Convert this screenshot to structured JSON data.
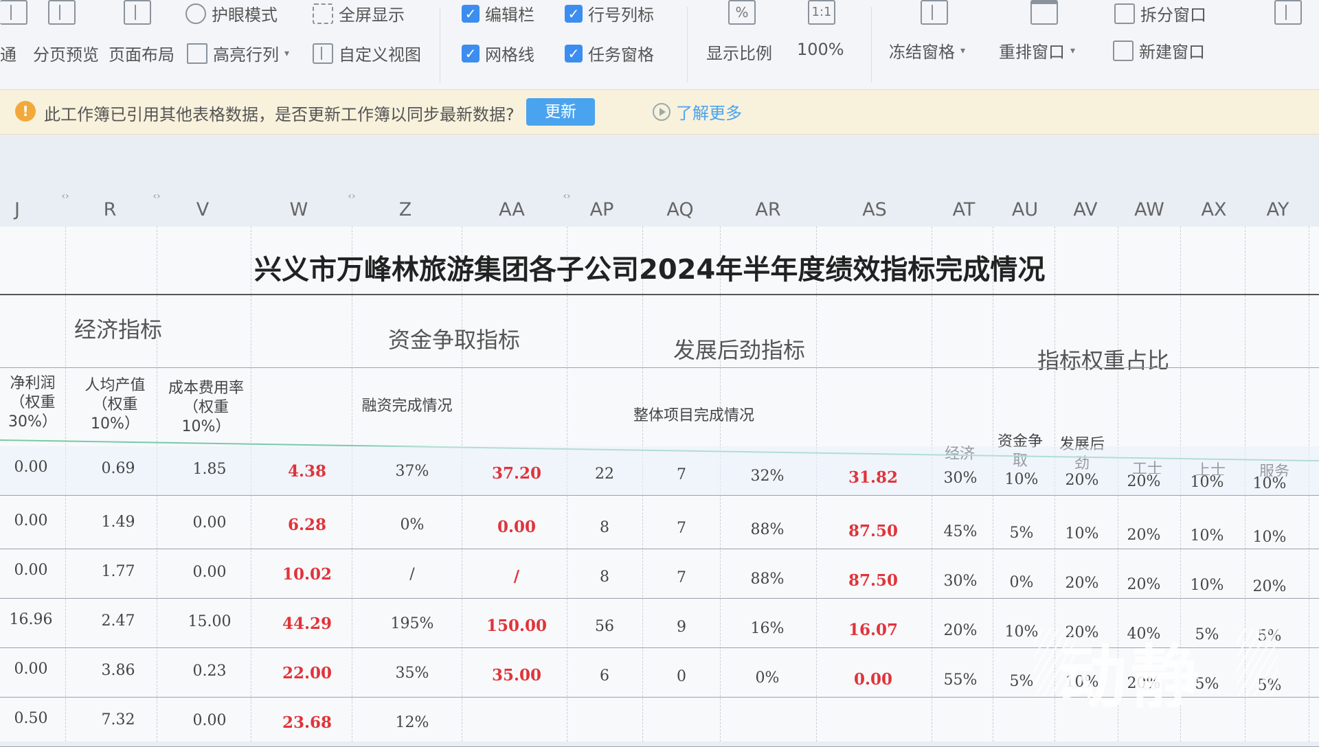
{
  "ribbon": {
    "row1": [
      {
        "name": "eye-protection-button",
        "label": "护眼模式"
      },
      {
        "name": "fullscreen-button",
        "label": "全屏显示"
      },
      {
        "name": "edit-bar-checkbox",
        "label": "编辑栏"
      },
      {
        "name": "row-col-headers-checkbox",
        "label": "行号列标"
      },
      {
        "name": "split-window-button",
        "label": "拆分窗口"
      }
    ],
    "row2": [
      {
        "name": "normal-view-button",
        "label": "通"
      },
      {
        "name": "page-break-preview-button",
        "label": "分页预览"
      },
      {
        "name": "page-layout-button",
        "label": "页面布局"
      },
      {
        "name": "highlight-rowcol-button",
        "label": "高亮行列"
      },
      {
        "name": "custom-view-button",
        "label": "自定义视图"
      },
      {
        "name": "gridlines-checkbox",
        "label": "网格线"
      },
      {
        "name": "task-pane-checkbox",
        "label": "任务窗格"
      },
      {
        "name": "zoom-ratio-button",
        "label": "显示比例"
      },
      {
        "name": "zoom-100-button",
        "label": "100%"
      },
      {
        "name": "freeze-panes-button",
        "label": "冻结窗格"
      },
      {
        "name": "arrange-window-button",
        "label": "重排窗口"
      },
      {
        "name": "new-window-button",
        "label": "新建窗口"
      }
    ],
    "zoom_icon": "%",
    "one_to_one_icon": "1:1"
  },
  "notice": {
    "text": "此工作簿已引用其他表格数据，是否更新工作簿以同步最新数据?",
    "update_label": "更新",
    "learn_more": "了解更多"
  },
  "columns": [
    "J",
    "R",
    "V",
    "W",
    "Z",
    "AA",
    "AP",
    "AQ",
    "AR",
    "AS",
    "AT",
    "AU",
    "AV",
    "AW",
    "AX",
    "AY"
  ],
  "sheet": {
    "title": "兴义市万峰林旅游集团各子公司2024年半年度绩效指标完成情况",
    "groups": {
      "economic": "经济指标",
      "funding": "资金争取指标",
      "development": "发展后劲指标",
      "weights": "指标权重占比"
    },
    "subheaders": {
      "net_profit": "净利润（权重30%）",
      "per_capita": "人均产值（权重10%）",
      "cost_rate": "成本费用率（权重10%）",
      "financing": "融资完成情况",
      "projects": "整体项目完成情况",
      "w_economic": "经济",
      "w_funding": "资金争取",
      "w_development": "发展后劲",
      "w_col4": "工士",
      "w_col5": "上士",
      "w_col6": "服务"
    },
    "rows": [
      [
        "0.00",
        "0.69",
        "1.85",
        "4.38",
        "37%",
        "37.20",
        "22",
        "7",
        "32%",
        "31.82",
        "30%",
        "10%",
        "20%",
        "20%",
        "10%",
        "10%"
      ],
      [
        "0.00",
        "1.49",
        "0.00",
        "6.28",
        "0%",
        "0.00",
        "8",
        "7",
        "88%",
        "87.50",
        "45%",
        "5%",
        "10%",
        "20%",
        "10%",
        "10%"
      ],
      [
        "0.00",
        "1.77",
        "0.00",
        "10.02",
        "/",
        "/",
        "8",
        "7",
        "88%",
        "87.50",
        "30%",
        "0%",
        "20%",
        "20%",
        "10%",
        "20%"
      ],
      [
        "16.96",
        "2.47",
        "15.00",
        "44.29",
        "195%",
        "150.00",
        "56",
        "9",
        "16%",
        "16.07",
        "20%",
        "10%",
        "20%",
        "40%",
        "5%",
        "5%"
      ],
      [
        "0.00",
        "3.86",
        "0.23",
        "22.00",
        "35%",
        "35.00",
        "6",
        "0",
        "0%",
        "0.00",
        "55%",
        "5%",
        "10%",
        "20%",
        "5%",
        "5%"
      ],
      [
        "0.50",
        "7.32",
        "0.00",
        "23.68",
        "12%",
        "",
        "",
        "",
        "",
        "",
        "",
        "",
        "",
        "",
        "",
        ""
      ]
    ]
  },
  "watermark": "动静"
}
